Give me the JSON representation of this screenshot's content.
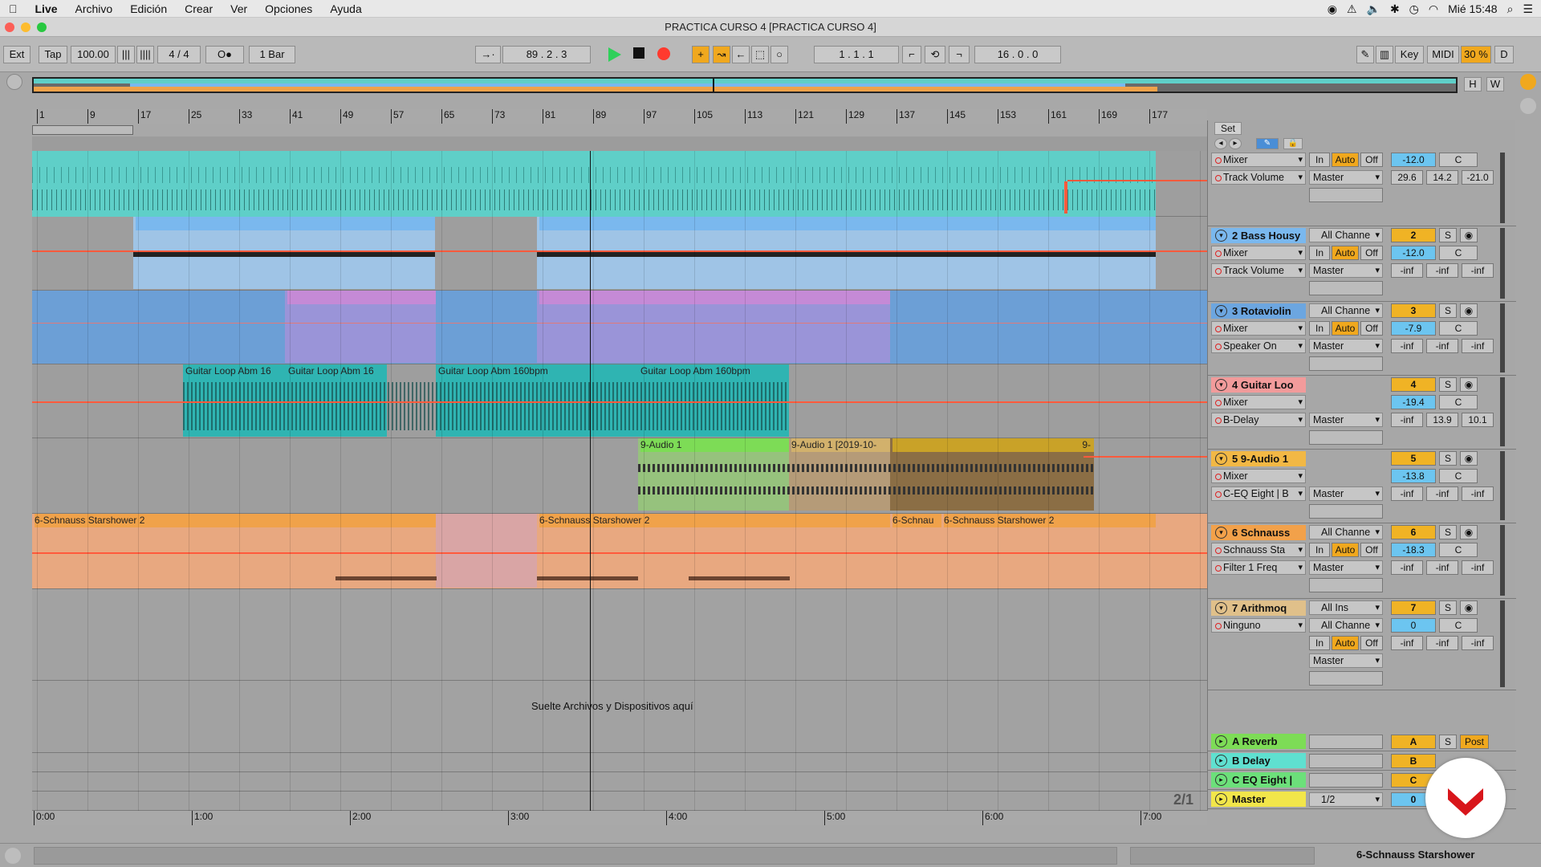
{
  "menubar": {
    "app_name": "Live",
    "items": [
      "Archivo",
      "Edición",
      "Crear",
      "Ver",
      "Opciones",
      "Ayuda"
    ],
    "clock": "Mié 15:48"
  },
  "window": {
    "title": "PRACTICA CURSO 4  [PRACTICA CURSO 4]"
  },
  "control_bar": {
    "ext": "Ext",
    "tap": "Tap",
    "tempo": "100.00",
    "signature": "4 / 4",
    "metronome": "O●",
    "quantize": "1 Bar",
    "position": "89 .  2 .  3",
    "loop_start": "1 .  1 .  1",
    "loop_length": "16 .  0 .  0",
    "key": "Key",
    "midi": "MIDI",
    "cpu": "30 %",
    "d": "D"
  },
  "overview": {
    "h": "H",
    "w": "W"
  },
  "ruler_ticks": [
    "1",
    "9",
    "17",
    "25",
    "33",
    "41",
    "49",
    "57",
    "65",
    "73",
    "81",
    "89",
    "97",
    "105",
    "113",
    "121",
    "129",
    "137",
    "145",
    "153",
    "161",
    "169",
    "177"
  ],
  "time_ticks": [
    "0:00",
    "1:00",
    "2:00",
    "3:00",
    "4:00",
    "5:00",
    "6:00",
    "7:00"
  ],
  "set_label": "Set",
  "clips": {
    "guitar1": "Guitar Loop Abm 16",
    "guitar2": "Guitar Loop Abm 16",
    "guitar3": "Guitar Loop Abm 160bpm",
    "guitar4": "Guitar Loop Abm 160bpm",
    "audio1": "9-Audio 1",
    "audio2": "9-Audio 1 [2019-10-",
    "audio3": "9-",
    "schnauss1": "6-Schnauss Starshower 2",
    "schnauss2": "6-Schnauss Starshower 2",
    "schnauss3": "6-Schnau",
    "schnauss4": "6-Schnauss Starshower 2"
  },
  "drop_text": "Suelte Archivos y Dispositivos aquí",
  "grid_ratio": "2/1",
  "tracks": [
    {
      "name": "",
      "d1": "Mixer",
      "d2": "Track Volume",
      "route": "Master",
      "in": "In",
      "auto": "Auto",
      "off": "Off",
      "vol": "-12.0",
      "pan": "C",
      "v1": "29.6",
      "v2": "14.2",
      "v3": "-21.0"
    },
    {
      "name": "2 Bass Housy",
      "input": "All Channe",
      "d1": "Mixer",
      "d2": "Track Volume",
      "route": "Master",
      "in": "In",
      "auto": "Auto",
      "off": "Off",
      "num": "2",
      "s": "S",
      "vol": "-12.0",
      "pan": "C",
      "v1": "-inf",
      "v2": "-inf",
      "v3": "-inf"
    },
    {
      "name": "3 Rotaviolin",
      "input": "All Channe",
      "d1": "Mixer",
      "d2": "Speaker On",
      "route": "Master",
      "in": "In",
      "auto": "Auto",
      "off": "Off",
      "num": "3",
      "s": "S",
      "vol": "-7.9",
      "pan": "C",
      "v1": "-inf",
      "v2": "-inf",
      "v3": "-inf"
    },
    {
      "name": "4 Guitar Loo",
      "d1": "Mixer",
      "d2": "B-Delay",
      "route": "Master",
      "num": "4",
      "s": "S",
      "vol": "-19.4",
      "pan": "C",
      "v1": "-inf",
      "v2": "13.9",
      "v3": "10.1"
    },
    {
      "name": "5 9-Audio 1",
      "d1": "Mixer",
      "d2": "C-EQ Eight | B",
      "route": "Master",
      "num": "5",
      "s": "S",
      "vol": "-13.8",
      "pan": "C",
      "v1": "-inf",
      "v2": "-inf",
      "v3": "-inf"
    },
    {
      "name": "6 Schnauss",
      "input": "All Channe",
      "d1": "Schnauss Sta",
      "d2": "Filter 1 Freq",
      "route": "Master",
      "in": "In",
      "auto": "Auto",
      "off": "Off",
      "num": "6",
      "s": "S",
      "vol": "-18.3",
      "pan": "C",
      "v1": "-inf",
      "v2": "-inf",
      "v3": "-inf"
    },
    {
      "name": "7 Arithmoq",
      "input": "All Ins",
      "input2": "All Channe",
      "d1": "Ninguno",
      "route": "Master",
      "in": "In",
      "auto": "Auto",
      "off": "Off",
      "num": "7",
      "s": "S",
      "vol": "0",
      "pan": "C",
      "v1": "-inf",
      "v2": "-inf",
      "v3": "-inf"
    }
  ],
  "returns": [
    {
      "name": "A Reverb",
      "letter": "A",
      "s": "S",
      "post": "Post"
    },
    {
      "name": "B Delay",
      "letter": "B"
    },
    {
      "name": "C EQ Eight |",
      "letter": "C"
    },
    {
      "name": "Master",
      "route": "1/2",
      "num": "0"
    }
  ],
  "status": {
    "selected_clip": "6-Schnauss Starshower"
  },
  "colors": {
    "cyan": "#5fcfc8",
    "blue": "#7ab8ee",
    "purple": "#c58ad6",
    "teal": "#2fb4b2",
    "green": "#7ddc56",
    "orange": "#f0a24a",
    "red_auto": "#ff5a3c"
  }
}
